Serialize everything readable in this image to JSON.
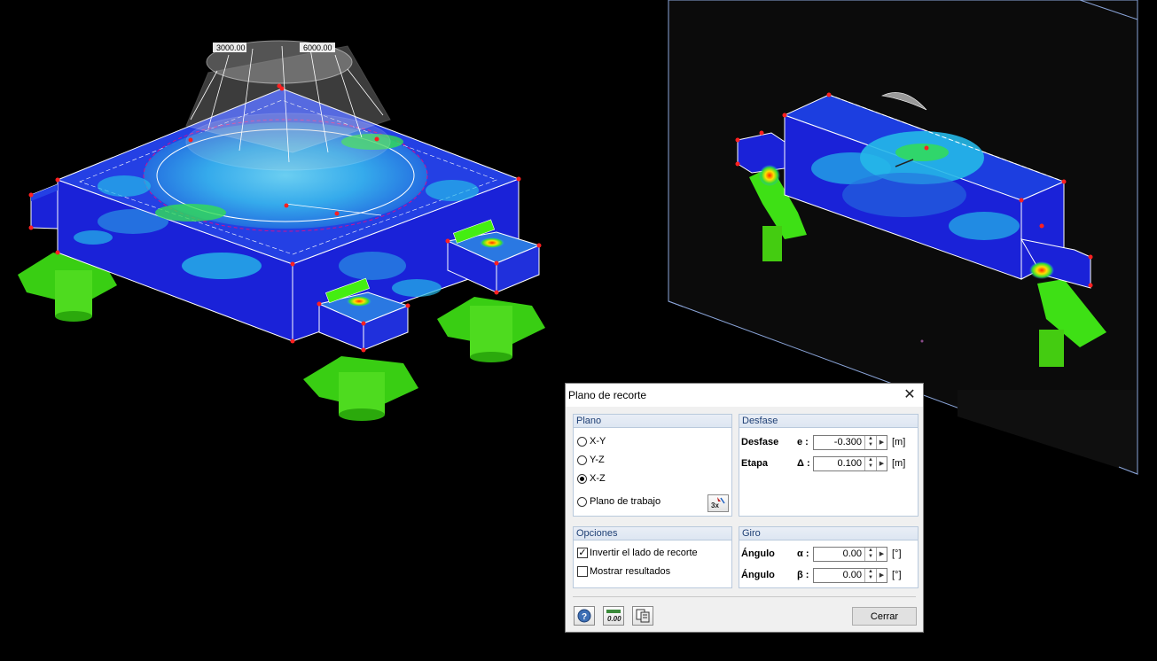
{
  "viewport": {
    "load_labels": [
      "3000.00",
      "6000.00"
    ],
    "colors": {
      "background": "#000000",
      "slab_blue": "#1a22d8",
      "stress_cyan": "#25b8e8",
      "support_green": "#44ee11"
    }
  },
  "dialog": {
    "title": "Plano de recorte",
    "close_icon": "close-icon",
    "plano": {
      "header": "Plano",
      "options": [
        {
          "label": "X-Y",
          "selected": false
        },
        {
          "label": "Y-Z",
          "selected": false
        },
        {
          "label": "X-Z",
          "selected": true
        },
        {
          "label": "Plano de trabajo",
          "selected": false
        }
      ],
      "workplane_icon": "work-plane-icon"
    },
    "desfase": {
      "header": "Desfase",
      "rows": [
        {
          "label": "Desfase",
          "symbol": "e :",
          "value": "-0.300",
          "unit": "[m]"
        },
        {
          "label": "Etapa",
          "symbol": "Δ :",
          "value": "0.100",
          "unit": "[m]"
        }
      ]
    },
    "opciones": {
      "header": "Opciones",
      "items": [
        {
          "label": "Invertir el lado de recorte",
          "checked": true
        },
        {
          "label": "Mostrar resultados",
          "checked": false
        }
      ]
    },
    "giro": {
      "header": "Giro",
      "rows": [
        {
          "label": "Ángulo",
          "symbol": "α :",
          "value": "0.00",
          "unit": "[°]"
        },
        {
          "label": "Ángulo",
          "symbol": "β :",
          "value": "0.00",
          "unit": "[°]"
        }
      ]
    },
    "footer": {
      "icons": [
        "help-icon",
        "units-icon",
        "copy-icon"
      ],
      "close_label": "Cerrar"
    }
  }
}
